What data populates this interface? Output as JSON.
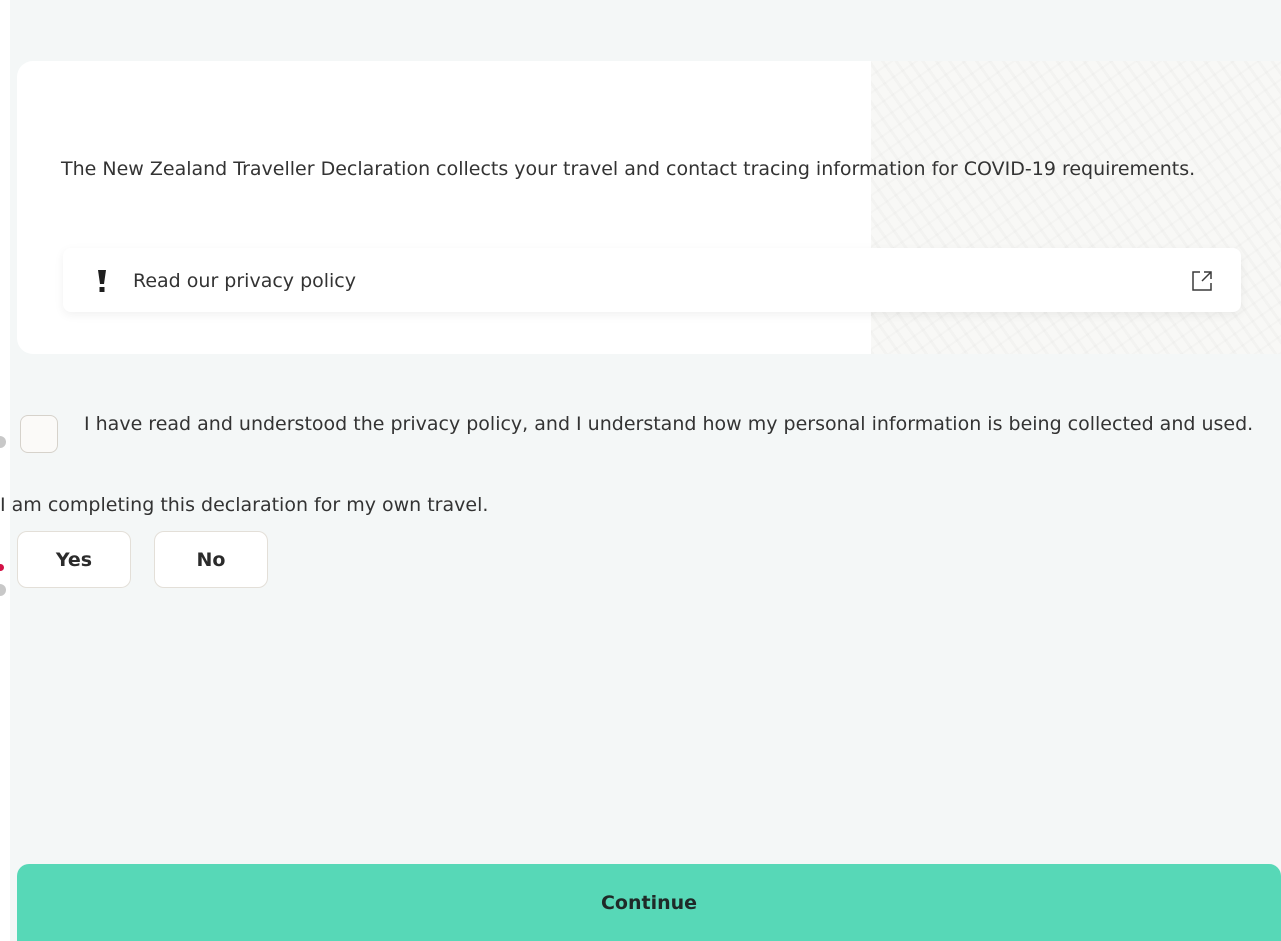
{
  "info_card": {
    "intro_text": "The New Zealand Traveller Declaration collects your travel and contact tracing information for COVID-19 requirements.",
    "privacy_link_label": "Read our privacy policy",
    "alert_icon": "exclamation-icon",
    "external_icon": "external-link-icon"
  },
  "consent": {
    "checked": false,
    "label": "I have read and understood the privacy policy, and I understand how my personal information is being collected and used."
  },
  "own_travel": {
    "question": "I am completing this declaration for my own travel.",
    "options": [
      "Yes",
      "No"
    ]
  },
  "footer": {
    "continue_label": "Continue"
  },
  "colors": {
    "background": "#f4f7f7",
    "card": "#ffffff",
    "primary_button": "#57d8b7",
    "focus_dot": "#d31145"
  }
}
